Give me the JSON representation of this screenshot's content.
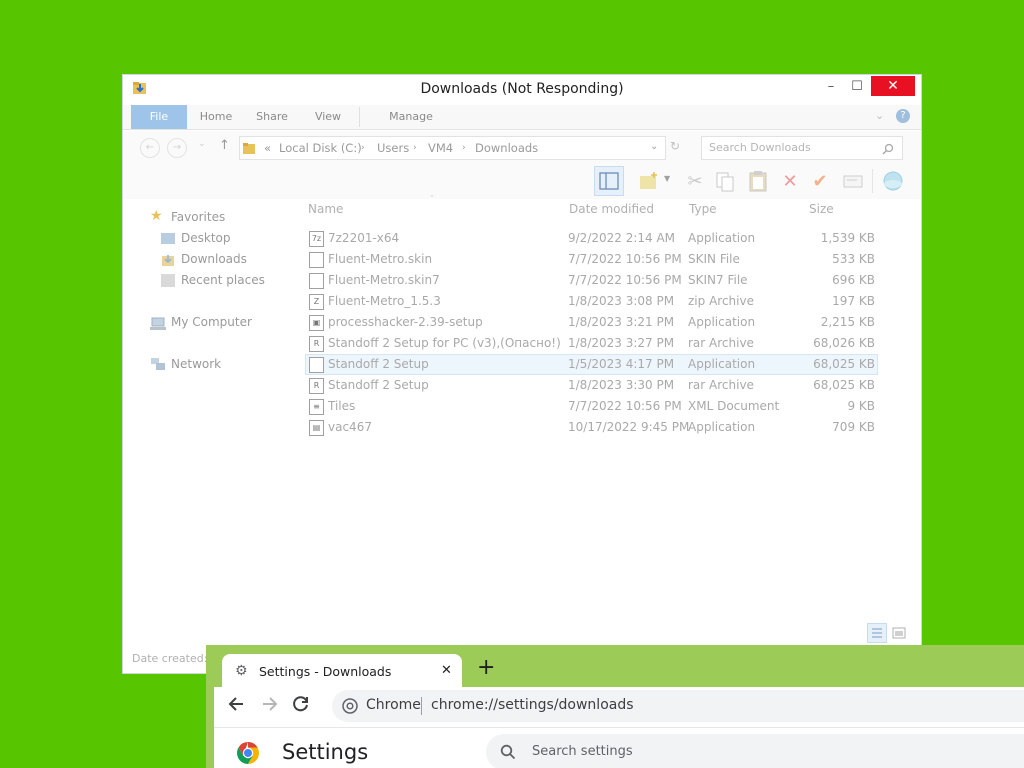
{
  "explorer": {
    "title": "Downloads (Not Responding)",
    "window_buttons": {
      "minimize": "–",
      "maximize": "☐",
      "close": "✕"
    },
    "ribbon_tabs": [
      "File",
      "Home",
      "Share",
      "View",
      "Manage"
    ],
    "address": {
      "prefix": "«",
      "crumbs": [
        "Local Disk (C:)",
        "Users",
        "VM4",
        "Downloads"
      ],
      "search_placeholder": "Search Downloads"
    },
    "nav": {
      "favorites": "Favorites",
      "desktop": "Desktop",
      "downloads": "Downloads",
      "recent": "Recent places",
      "computer": "My Computer",
      "network": "Network"
    },
    "columns": [
      "Name",
      "Date modified",
      "Type",
      "Size"
    ],
    "files": [
      {
        "name": "7z2201-x64",
        "date": "9/2/2022 2:14 AM",
        "type": "Application",
        "size": "1,539 KB",
        "icon": "7z"
      },
      {
        "name": "Fluent-Metro.skin",
        "date": "7/7/2022 10:56 PM",
        "type": "SKIN File",
        "size": "533 KB",
        "icon": ""
      },
      {
        "name": "Fluent-Metro.skin7",
        "date": "7/7/2022 10:56 PM",
        "type": "SKIN7 File",
        "size": "696 KB",
        "icon": ""
      },
      {
        "name": "Fluent-Metro_1.5.3",
        "date": "1/8/2023 3:08 PM",
        "type": "zip Archive",
        "size": "197 KB",
        "icon": "Z"
      },
      {
        "name": "processhacker-2.39-setup",
        "date": "1/8/2023 3:21 PM",
        "type": "Application",
        "size": "2,215 KB",
        "icon": "▣"
      },
      {
        "name": "Standoff 2 Setup for PC (v3),(Опасно!)",
        "date": "1/8/2023 3:27 PM",
        "type": "rar Archive",
        "size": "68,026 KB",
        "icon": "R"
      },
      {
        "name": "Standoff 2 Setup",
        "date": "1/5/2023 4:17 PM",
        "type": "Application",
        "size": "68,025 KB",
        "icon": ""
      },
      {
        "name": "Standoff 2 Setup",
        "date": "1/8/2023 3:30 PM",
        "type": "rar Archive",
        "size": "68,025 KB",
        "icon": "R"
      },
      {
        "name": "Tiles",
        "date": "7/7/2022 10:56 PM",
        "type": "XML Document",
        "size": "9 KB",
        "icon": "≡"
      },
      {
        "name": "vac467",
        "date": "10/17/2022 9:45 PM",
        "type": "Application",
        "size": "709 KB",
        "icon": "▤"
      }
    ],
    "status_text": "Date created:"
  },
  "chrome": {
    "tab_title": "Settings - Downloads",
    "tab_close": "✕",
    "new_tab": "+",
    "omnibox_label": "Chrome",
    "url": "chrome://settings/downloads",
    "page_title": "Settings",
    "search_placeholder": "Search settings"
  },
  "colors": {
    "desktop": "#57c600",
    "chrome_frame": "#9ccc57",
    "close_button": "#e81123",
    "file_tab": "#9fc4ea"
  }
}
